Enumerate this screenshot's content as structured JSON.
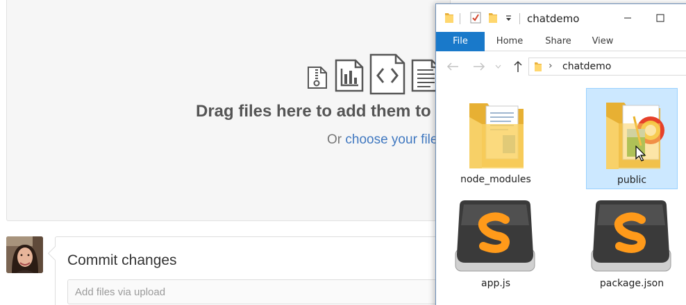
{
  "github": {
    "drop_title": "Drag files here to add them to your repository",
    "drop_sub_prefix": "Or",
    "drop_sub_link": "choose your files",
    "file_type_icons": [
      "zip-file-icon",
      "chart-file-icon",
      "code-file-icon",
      "text-file-icon"
    ],
    "commit_title": "Commit changes",
    "commit_placeholder": "Add files via upload"
  },
  "explorer": {
    "title": "chatdemo",
    "ribbon_tabs": [
      "File",
      "Home",
      "Share",
      "View"
    ],
    "address_path": "chatdemo",
    "items": [
      {
        "label": "node_modules",
        "kind": "folder",
        "selected": false
      },
      {
        "label": "public",
        "kind": "folder",
        "selected": true
      },
      {
        "label": "app.js",
        "kind": "sublime-file",
        "selected": false
      },
      {
        "label": "package.json",
        "kind": "sublime-file",
        "selected": false
      }
    ]
  },
  "colors": {
    "accent_link": "#4078c0",
    "ribbon_file": "#1979ca",
    "selection_bg": "#cce8ff",
    "selection_border": "#99d1ff"
  }
}
